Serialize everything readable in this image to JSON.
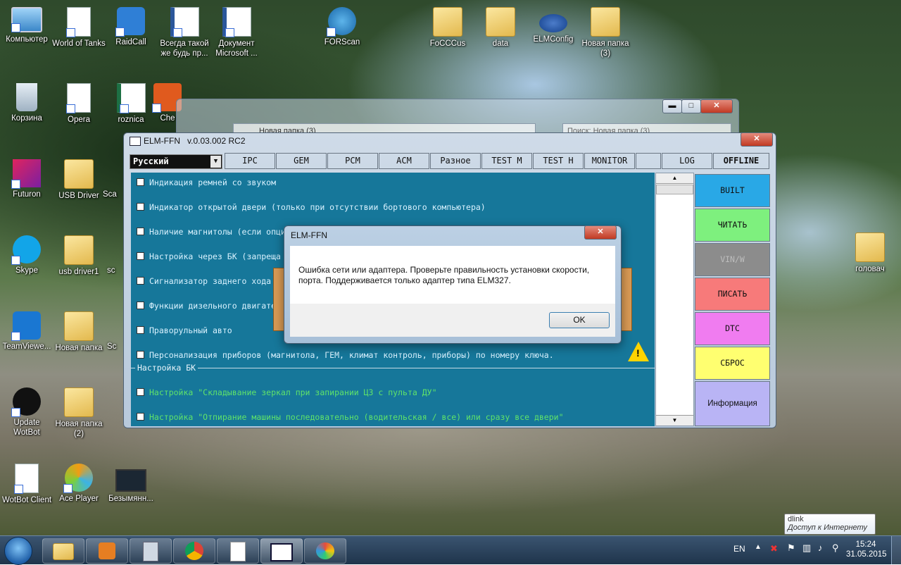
{
  "desktop_icons": [
    {
      "label": "Компьютер",
      "icon": "computer-icon"
    },
    {
      "label": "World of Tanks",
      "icon": "document-icon"
    },
    {
      "label": "RaidCall",
      "icon": "raidcall-icon"
    },
    {
      "label": "Всегда такой же будь пр...",
      "icon": "word-document-icon"
    },
    {
      "label": "Документ Microsoft ...",
      "icon": "word-document-icon"
    },
    {
      "label": "FORScan",
      "icon": "forscan-icon"
    },
    {
      "label": "FoCCCus",
      "icon": "folder-icon"
    },
    {
      "label": "data",
      "icon": "folder-icon"
    },
    {
      "label": "ELMConfig",
      "icon": "ford-icon"
    },
    {
      "label": "Новая папка (3)",
      "icon": "folder-icon"
    },
    {
      "label": "Корзина",
      "icon": "recycle-bin-icon"
    },
    {
      "label": "Opera",
      "icon": "document-icon"
    },
    {
      "label": "roznica",
      "icon": "excel-icon"
    },
    {
      "label": "Che",
      "icon": "check-app-icon"
    },
    {
      "label": "Futuron",
      "icon": "futuron-icon"
    },
    {
      "label": "USB Driver",
      "icon": "folder-icon"
    },
    {
      "label": "Sca",
      "icon": "app-icon"
    },
    {
      "label": "Skype",
      "icon": "skype-icon"
    },
    {
      "label": "usb driver1",
      "icon": "folder-icon"
    },
    {
      "label": "sc",
      "icon": "app-icon"
    },
    {
      "label": "TeamViewe...",
      "icon": "teamviewer-icon"
    },
    {
      "label": "Новая папка",
      "icon": "folder-icon"
    },
    {
      "label": "Sc",
      "icon": "app-icon"
    },
    {
      "label": "Update WotBot",
      "icon": "wotbot-icon"
    },
    {
      "label": "Новая папка (2)",
      "icon": "folder-icon"
    },
    {
      "label": "WotBot Client",
      "icon": "document-icon"
    },
    {
      "label": "Ace Player",
      "icon": "ace-player-icon"
    },
    {
      "label": "Безымянн...",
      "icon": "video-icon"
    },
    {
      "label": "головач",
      "icon": "folder-icon"
    }
  ],
  "explorer": {
    "address": "Новая папка (3)",
    "search_placeholder": "Поиск: Новая папка (3)",
    "min_label": "▬",
    "max_label": "□",
    "close_label": "✕"
  },
  "app": {
    "title": "ELM-FFN",
    "version": "v.0.03.002 RC2",
    "close_label": "✕",
    "language": "Русский",
    "tabs": [
      {
        "label": "IPC",
        "color": "#d9e6f2"
      },
      {
        "label": "GEM",
        "color": "#a9d0ee"
      },
      {
        "label": "PCM",
        "color": "#a9d0ee"
      },
      {
        "label": "ACM",
        "color": "#a9d0ee"
      },
      {
        "label": "Разное",
        "color": "#a9d0ee"
      },
      {
        "label": "TEST M",
        "color": "#c8c8c8"
      },
      {
        "label": "TEST H",
        "color": "#f6a6e6"
      },
      {
        "label": "MONITOR",
        "color": "#3fbf52"
      },
      {
        "label": "",
        "color": "#ffffff"
      },
      {
        "label": "LOG",
        "color": "#a9d0ee"
      },
      {
        "label": "OFFLINE",
        "color": "#ffff33"
      }
    ],
    "options": [
      "Индикация ремней со звуком",
      "Индикатор открытой двери (только при отсутствии бортового компьютера)",
      "Наличие магнитолы (если опци",
      "Настройка через БК (запреща",
      "Сигнализатор заднего хода",
      "Функции дизельного двигате",
      "Праворульный авто",
      "Персонализация приборов (магнитола, ГЕМ, климат контроль, приборы) по номеру ключа."
    ],
    "section_title": "Настройка БК",
    "bk_options": [
      "Настройка \"Складывание зеркал при запирании ЦЗ с пульта ДУ\"",
      "Настройка \"Отпирание машины последовательно (водительская / все) или сразу все двери\""
    ],
    "side_buttons": [
      {
        "label": "BUILT",
        "color": "#29a8e6"
      },
      {
        "label": "ЧИТАТЬ",
        "color": "#7ef07e"
      },
      {
        "label": "VIN/W",
        "color": "#8c8c8c"
      },
      {
        "label": "ПИСАТЬ",
        "color": "#f77a7a"
      },
      {
        "label": "DTC",
        "color": "#f07cf0"
      },
      {
        "label": "СБРОС",
        "color": "#ffff70"
      },
      {
        "label": "Информация",
        "color": "#b9b4f5"
      }
    ]
  },
  "dialog": {
    "title": "ELM-FFN",
    "message": "Ошибка сети или адаптера. Проверьте правильность установки скорости, порта. Поддерживается только адаптер типа ELM327.",
    "ok_label": "OK",
    "close_label": "✕"
  },
  "tooltip": {
    "title": "dlink",
    "text": "Доступ к Интернету"
  },
  "taskbar": {
    "language": "EN",
    "time": "15:24",
    "date": "31.05.2015"
  }
}
